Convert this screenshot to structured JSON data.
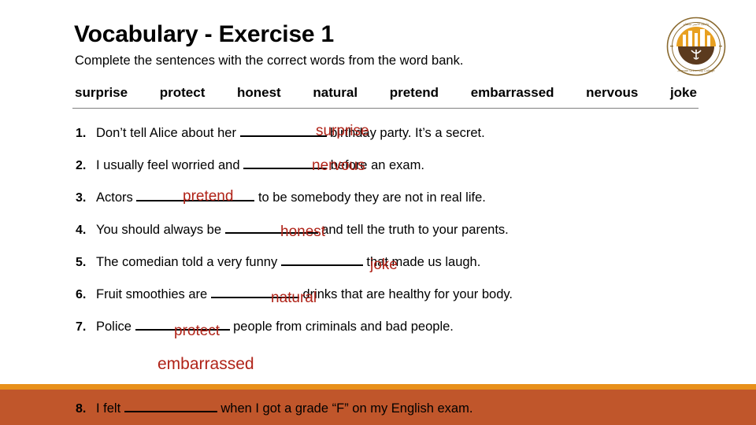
{
  "header": {
    "title": "Vocabulary - Exercise 1",
    "subtitle": "Complete the sentences with the correct words from the word bank."
  },
  "logo": {
    "name": "university-seal",
    "arabic_top": "جامعة الأمير سطام",
    "latin_bottom": "Amman University College"
  },
  "word_bank": {
    "words": [
      "surprise",
      "protect",
      "honest",
      "natural",
      "pretend",
      "embarrassed",
      "nervous",
      "joke"
    ]
  },
  "questions": [
    {
      "number": "1.",
      "before": "Don’t tell Alice about her ",
      "blank_width": 110,
      "after": " birthday party. It’s a secret."
    },
    {
      "number": "2.",
      "before": "I usually feel worried and ",
      "blank_width": 106,
      "after": " before an exam."
    },
    {
      "number": "3.",
      "before": "Actors ",
      "blank_width": 150,
      "after": " to be somebody they are not in real life."
    },
    {
      "number": "4.",
      "before": "You should always be ",
      "blank_width": 118,
      "after": " and tell the truth to your parents."
    },
    {
      "number": "5.",
      "before": "The comedian told a very funny ",
      "blank_width": 104,
      "after": " that made us laugh."
    },
    {
      "number": "6.",
      "before": "Fruit smoothies are ",
      "blank_width": 112,
      "after": " drinks that are healthy for your body."
    },
    {
      "number": "7.",
      "before": "Police ",
      "blank_width": 120,
      "after": " people from criminals and bad people."
    },
    {
      "number": "8.",
      "before": "I felt ",
      "blank_width": 118,
      "after": " when I got a grade “F” on my English exam."
    }
  ],
  "answers": {
    "a1": "surprise",
    "a2": "pretend",
    "a3": "honest",
    "a4": "joke",
    "a5": "natural",
    "a6": "protect",
    "a7": "embarrassed",
    "floating": "nervous"
  },
  "colors": {
    "answer_red": "#B02318",
    "band_light": "#E8901A",
    "band_dark": "#C0562B"
  }
}
